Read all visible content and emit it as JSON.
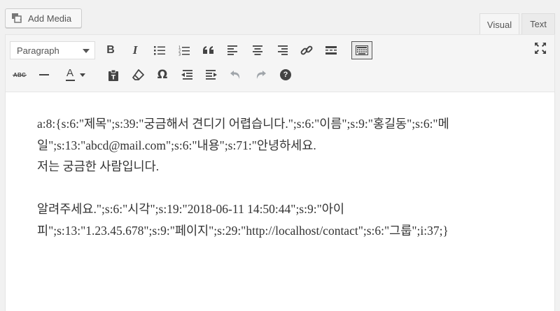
{
  "header": {
    "add_media_label": "Add Media",
    "tabs": [
      {
        "label": "Visual",
        "active": true
      },
      {
        "label": "Text",
        "active": false
      }
    ]
  },
  "toolbar": {
    "format_select_value": "Paragraph",
    "row1_icons": [
      "bold-icon",
      "italic-icon",
      "bulleted-list-icon",
      "numbered-list-icon",
      "blockquote-icon",
      "align-left-icon",
      "align-center-icon",
      "align-right-icon",
      "insert-link-icon",
      "read-more-icon",
      "toolbar-toggle-icon"
    ],
    "row2_icons": [
      "strikethrough-icon",
      "horizontal-line-icon",
      "text-color-icon",
      "paste-as-text-icon",
      "clear-formatting-icon",
      "special-character-icon",
      "decrease-indent-icon",
      "increase-indent-icon",
      "undo-icon",
      "redo-icon",
      "keyboard-shortcuts-icon"
    ],
    "fullscreen_icon": "fullscreen-icon",
    "strikethrough_glyph": "ABC",
    "text_color_glyph": "A",
    "omega_glyph": "Ω",
    "help_glyph": "?",
    "bold_glyph": "B",
    "italic_glyph": "I"
  },
  "editor": {
    "lines": [
      "a:8:{s:6:\"제목\";s:39:\"궁금해서 견디기 어렵습니다.\";s:6:\"이름\";s:9:\"홍길동\";s:6:\"메",
      "일\";s:13:\"abcd@mail.com\";s:6:\"내용\";s:71:\"안녕하세요.",
      "저는 궁금한 사람입니다.",
      "",
      "알려주세요.\";s:6:\"시각\";s:19:\"2018-06-11 14:50:44\";s:9:\"아이",
      "피\";s:13:\"1.23.45.678\";s:9:\"페이지\";s:29:\"http://localhost/contact\";s:6:\"그룹\";i:37;}"
    ]
  },
  "colors": {
    "background": "#f1f1f1",
    "toolbar": "#f5f5f5",
    "text": "#333333",
    "icon": "#444444"
  }
}
